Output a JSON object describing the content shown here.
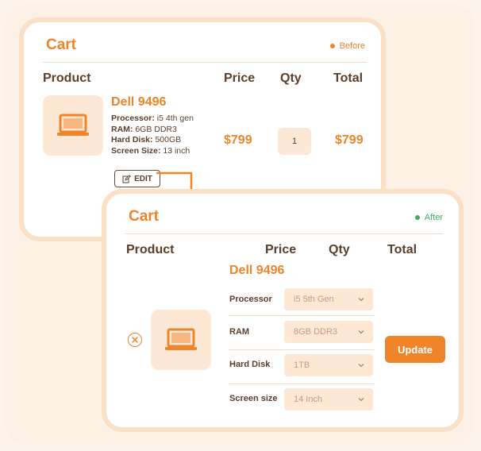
{
  "before": {
    "title": "Cart",
    "state": "Before",
    "state_color": "#ef8429",
    "headers": {
      "product": "Product",
      "price": "Price",
      "qty": "Qty",
      "total": "Total"
    },
    "product": {
      "name": "Dell 9496",
      "icon": "laptop-icon",
      "specs": [
        {
          "label": "Processor:",
          "value": "i5 4th gen"
        },
        {
          "label": "RAM:",
          "value": "6GB DDR3"
        },
        {
          "label": "Hard Disk:",
          "value": "500GB"
        },
        {
          "label": "Screen Size:",
          "value": "13 inch"
        }
      ]
    },
    "edit_label": "EDIT",
    "edit_icon": "edit-icon",
    "price": "$799",
    "qty": "1",
    "total": "$799"
  },
  "after": {
    "title": "Cart",
    "state": "After",
    "state_color": "#3fae5a",
    "headers": {
      "product": "Product",
      "price": "Price",
      "qty": "Qty",
      "total": "Total"
    },
    "product": {
      "name": "Dell 9496",
      "icon": "laptop-icon"
    },
    "remove_icon": "close-circle-icon",
    "options": [
      {
        "label": "Processor",
        "value": "i5 5th Gen"
      },
      {
        "label": "RAM",
        "value": "8GB DDR3"
      },
      {
        "label": "Hard Disk",
        "value": "1TB"
      },
      {
        "label": "Screen size",
        "value": "14 Inch"
      }
    ],
    "update_label": "Update"
  },
  "colors": {
    "accent": "#ef8429",
    "text": "#5a3f2c",
    "tint": "#fde8d6"
  }
}
